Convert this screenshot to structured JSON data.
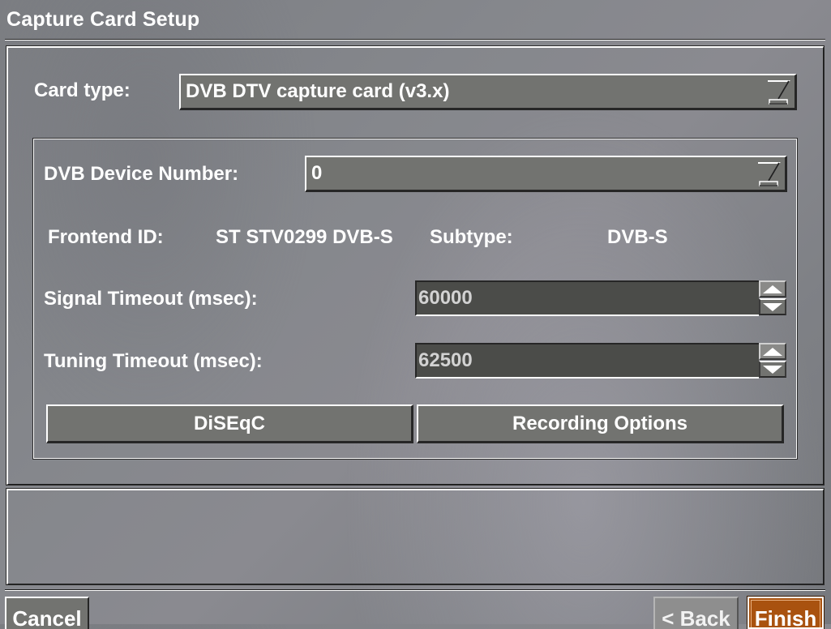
{
  "window": {
    "title": "Capture Card Setup"
  },
  "card_type": {
    "label": "Card type:",
    "value": "DVB DTV capture card (v3.x)",
    "icon": "dropdown-arrow-icon"
  },
  "dvb": {
    "device_number": {
      "label": "DVB Device Number:",
      "value": "0",
      "icon": "dropdown-arrow-icon"
    },
    "frontend_id": {
      "label": "Frontend ID:",
      "value": "ST STV0299 DVB-S"
    },
    "subtype": {
      "label": "Subtype:",
      "value": "DVB-S"
    },
    "signal_timeout": {
      "label": "Signal Timeout (msec):",
      "value": "60000"
    },
    "tuning_timeout": {
      "label": "Tuning Timeout (msec):",
      "value": "62500"
    },
    "buttons": {
      "diseqc": "DiSEqC",
      "recording_options": "Recording Options"
    }
  },
  "help_text": "",
  "footer": {
    "cancel": "Cancel",
    "back": "< Back",
    "finish": "Finish"
  },
  "colors": {
    "finish_accent": "#a9520f",
    "field_bg": "#727370",
    "spin_field_bg": "#4b4c49"
  }
}
